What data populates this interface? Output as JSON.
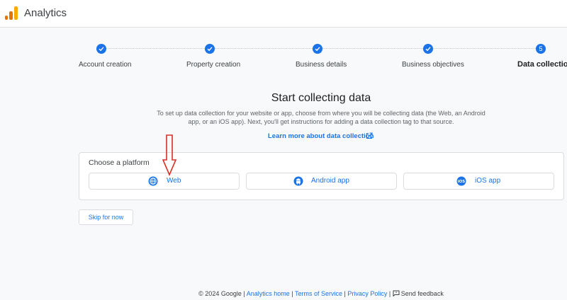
{
  "header": {
    "app_title": "Analytics",
    "logo_icon": "analytics-logo-icon"
  },
  "stepper": {
    "steps": [
      {
        "label": "Account creation",
        "state": "done"
      },
      {
        "label": "Property creation",
        "state": "done"
      },
      {
        "label": "Business details",
        "state": "done"
      },
      {
        "label": "Business objectives",
        "state": "done"
      },
      {
        "label": "Data collection",
        "state": "current",
        "number": "5"
      }
    ]
  },
  "main": {
    "title": "Start collecting data",
    "description": "To set up data collection for your website or app, choose from where you will be collecting data (the Web, an Android app, or an iOS app). Next, you'll get instructions for adding a data collection tag to that source.",
    "learn_more": "Learn more about data collection",
    "platform_card": {
      "title": "Choose a platform",
      "options": [
        {
          "label": "Web",
          "icon": "globe-icon"
        },
        {
          "label": "Android app",
          "icon": "android-icon"
        },
        {
          "label": "iOS app",
          "icon": "ios-icon"
        }
      ]
    },
    "skip_label": "Skip for now"
  },
  "footer": {
    "copyright": "© 2024 Google",
    "sep": "|",
    "analytics_home": "Analytics home",
    "terms": "Terms of Service",
    "privacy": "Privacy Policy",
    "feedback": "Send feedback"
  },
  "colors": {
    "accent": "#1a73e8",
    "annotation_arrow": "#d93025"
  }
}
